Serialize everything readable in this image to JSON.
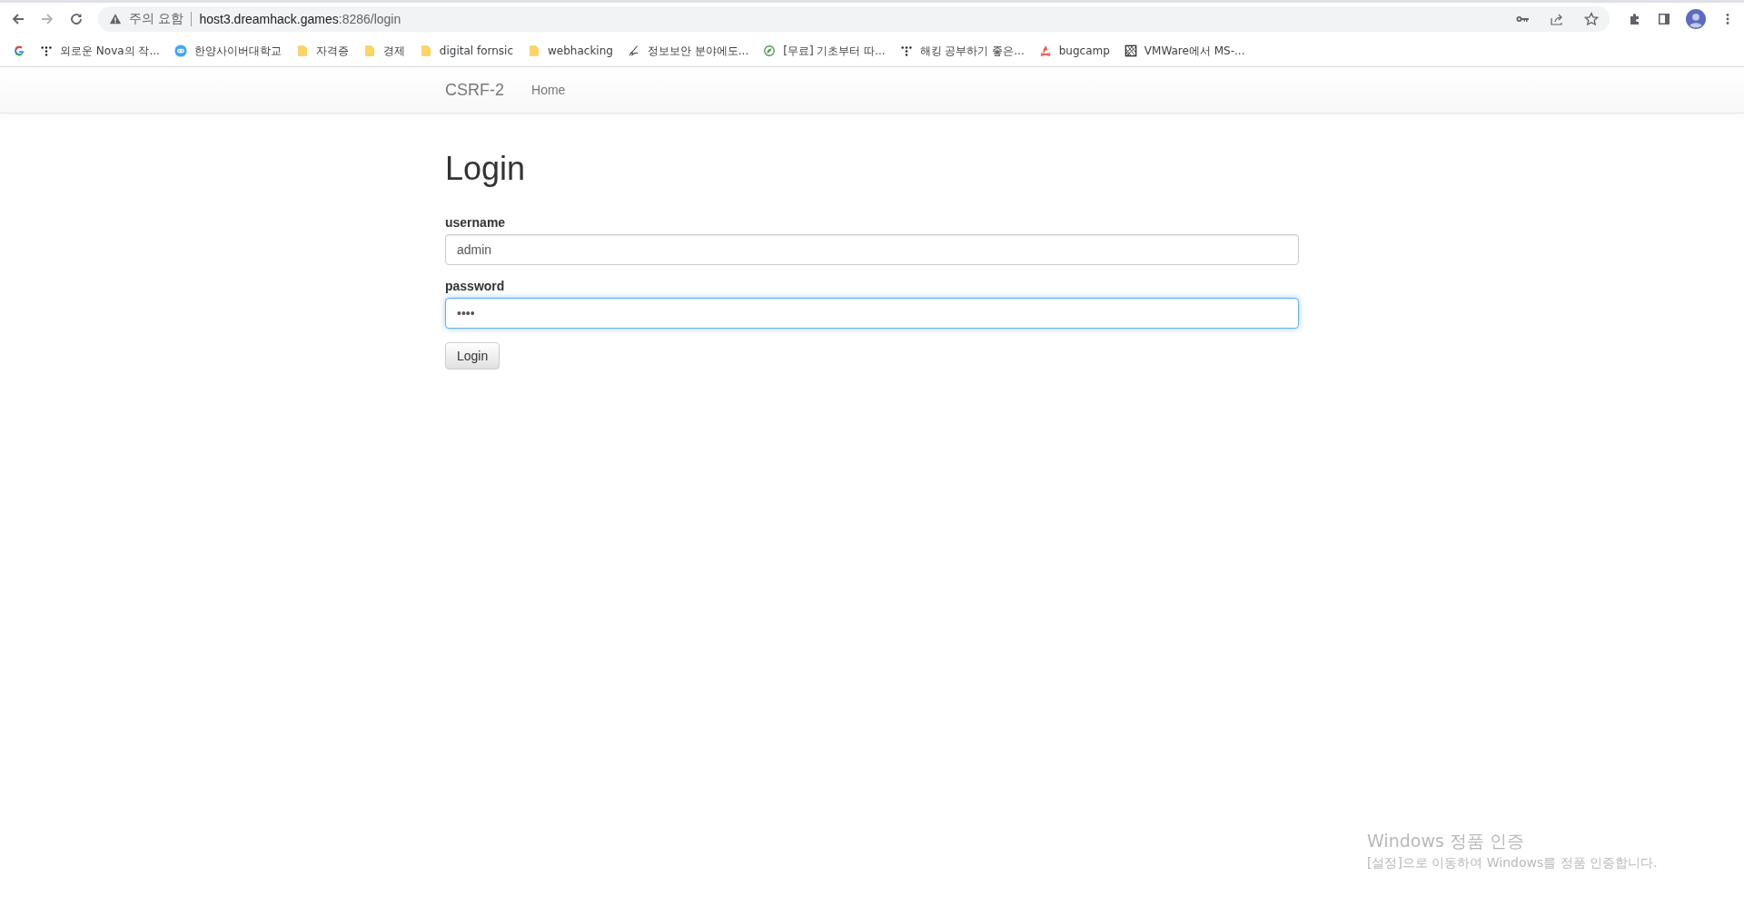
{
  "browser": {
    "security_label": "주의 요함",
    "url_host": "host3.dreamhack.games",
    "url_path": ":8286/login",
    "bookmarks": [
      {
        "kind": "google"
      },
      {
        "kind": "dots",
        "label": "외로운 Nova의 작..."
      },
      {
        "kind": "badge",
        "label": "한양사이버대학교"
      },
      {
        "kind": "folder",
        "label": "자격증"
      },
      {
        "kind": "folder",
        "label": "경제"
      },
      {
        "kind": "folder",
        "label": "digital fornsic"
      },
      {
        "kind": "folder",
        "label": "webhacking"
      },
      {
        "kind": "pen",
        "label": "정보보안 분야에도..."
      },
      {
        "kind": "leaf",
        "label": "[무료] 기초부터 따..."
      },
      {
        "kind": "dots",
        "label": "해킹 공부하기 좋은..."
      },
      {
        "kind": "flame",
        "label": "bugcamp"
      },
      {
        "kind": "grid",
        "label": "VMWare에서 MS-..."
      }
    ]
  },
  "navbar": {
    "brand": "CSRF-2",
    "links": [
      "Home"
    ]
  },
  "page": {
    "title": "Login",
    "fields": [
      {
        "label": "username",
        "value": "admin",
        "focused": false
      },
      {
        "label": "password",
        "value": "••••",
        "focused": true
      }
    ],
    "button": "Login"
  },
  "os_notice": {
    "title": "Windows 정품 인증",
    "message": "[설정]으로 이동하여 Windows를 정품 인증합니다."
  }
}
